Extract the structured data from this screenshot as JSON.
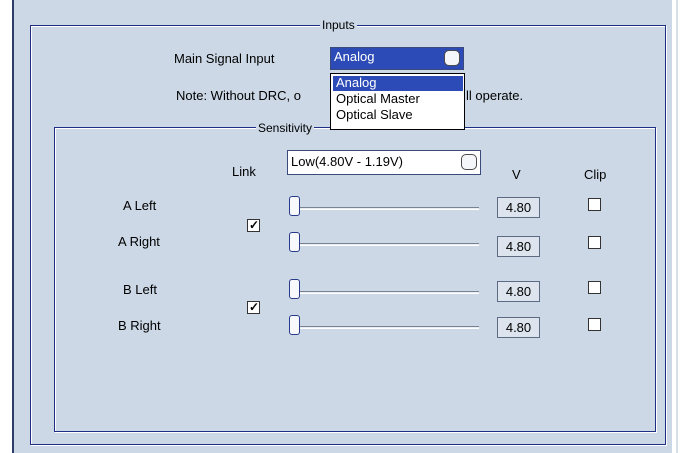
{
  "inputs": {
    "title": "Inputs",
    "main_signal_label": "Main Signal Input",
    "main_signal_value": "Analog",
    "note_visible_left": "Note: Without DRC, o",
    "note_visible_right": "ll operate.",
    "options": [
      "Analog",
      "Optical Master",
      "Optical Slave"
    ],
    "selected_option": "Analog"
  },
  "sensitivity": {
    "title": "Sensitivity",
    "link_label": "Link",
    "range_value": "Low(4.80V - 1.19V)",
    "v_header": "V",
    "clip_header": "Clip",
    "channels": [
      {
        "label": "A Left",
        "value": "4.80",
        "level": 0,
        "clip": false
      },
      {
        "label": "A Right",
        "value": "4.80",
        "level": 0,
        "clip": false
      },
      {
        "label": "B Left",
        "value": "4.80",
        "level": 0,
        "clip": false
      },
      {
        "label": "B Right",
        "value": "4.80",
        "level": 0,
        "clip": false
      }
    ],
    "link_a": true,
    "link_b": true
  },
  "colors": {
    "panel_bg": "#ccd8e6",
    "frame_border": "#1f2f86",
    "selection": "#2c4bb6"
  }
}
